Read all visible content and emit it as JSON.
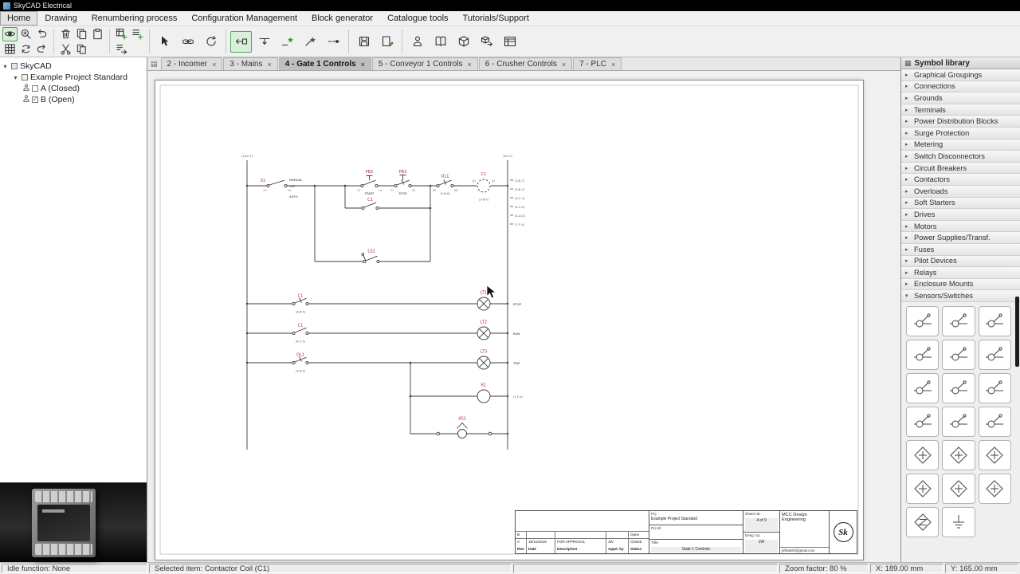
{
  "icons": {
    "close": "×",
    "chevron_right": "▸",
    "chevron_down": "▾",
    "tree_expanded": "▾",
    "header_symbol": "▦",
    "tab_strip": "▤",
    "check": "✓"
  },
  "titlebar": {
    "title": "SkyCAD Electrical"
  },
  "menubar": {
    "items": [
      {
        "label": "Home",
        "active": true
      },
      {
        "label": "Drawing"
      },
      {
        "label": "Renumbering process"
      },
      {
        "label": "Configuration Management"
      },
      {
        "label": "Block generator"
      },
      {
        "label": "Catalogue tools"
      },
      {
        "label": "Tutorials/Support"
      }
    ]
  },
  "tree": {
    "root": "SkyCAD",
    "project": "Example Project Standard",
    "sheets": [
      {
        "label": "A (Closed)"
      },
      {
        "label": "B (Open)",
        "checked": true
      }
    ]
  },
  "tabs": [
    {
      "label": "2 - Incomer"
    },
    {
      "label": "3 - Mains"
    },
    {
      "label": "4 - Gate 1 Controls",
      "active": true
    },
    {
      "label": "5 - Conveyor 1 Controls"
    },
    {
      "label": "6 - Crusher Controls"
    },
    {
      "label": "7 - PLC"
    }
  ],
  "symbol_library": {
    "header": "Symbol library",
    "categories": [
      {
        "label": "Graphical Groupings"
      },
      {
        "label": "Connections"
      },
      {
        "label": "Grounds"
      },
      {
        "label": "Terminals"
      },
      {
        "label": "Power Distribution Blocks"
      },
      {
        "label": "Surge Protection"
      },
      {
        "label": "Metering"
      },
      {
        "label": "Switch Disconnectors"
      },
      {
        "label": "Circuit Breakers"
      },
      {
        "label": "Contactors"
      },
      {
        "label": "Overloads"
      },
      {
        "label": "Soft Starters"
      },
      {
        "label": "Drives"
      },
      {
        "label": "Motors"
      },
      {
        "label": "Power Supplies/Transf."
      },
      {
        "label": "Fuses"
      },
      {
        "label": "Pilot Devices"
      },
      {
        "label": "Relays"
      },
      {
        "label": "Enclosure Mounts"
      },
      {
        "label": "Sensors/Switches",
        "expanded": true
      }
    ],
    "symbols": [
      {
        "kind": "circ"
      },
      {
        "kind": "circ"
      },
      {
        "kind": "circ"
      },
      {
        "kind": "circ"
      },
      {
        "kind": "circ"
      },
      {
        "kind": "circ"
      },
      {
        "kind": "circ"
      },
      {
        "kind": "circ"
      },
      {
        "kind": "circ"
      },
      {
        "kind": "circ"
      },
      {
        "kind": "circ"
      },
      {
        "kind": "circ"
      },
      {
        "kind": "diam"
      },
      {
        "kind": "diam"
      },
      {
        "kind": "diam"
      },
      {
        "kind": "diam"
      },
      {
        "kind": "diam"
      },
      {
        "kind": "diam"
      },
      {
        "kind": "diamz"
      },
      {
        "kind": "gnd"
      }
    ]
  },
  "schematic": {
    "rail_left_label": "(24V-1)",
    "rail_right_label": "(0V-1)",
    "s1": {
      "tag": "S1",
      "pos1": "MANUAL",
      "pos2": "OFF",
      "pos3": "AUTO",
      "t1": "13",
      "t2": "14"
    },
    "pb2": {
      "tag": "PB2",
      "func": "START",
      "t1": "13",
      "t2": "14"
    },
    "pb3": {
      "tag": "PB3",
      "func": "STOP",
      "t1": "21",
      "t2": "22"
    },
    "ol1": {
      "tag": "OL1",
      "ref": "(3-B-6)",
      "t1": "95",
      "t2": "96"
    },
    "coil": {
      "tag": "C1",
      "ref": "(3-B-7)",
      "t1": "A1",
      "t2": "A2"
    },
    "aux": {
      "tag": "C1"
    },
    "ls2": {
      "tag": "LS2"
    },
    "crossrefs": [
      "(3-B-7)",
      "(3-B-7)",
      "(4-C-4)",
      "(4-C-4)",
      "(4-D-4)",
      "(7-F-4)"
    ],
    "lamp1": {
      "contact_tag": "C1",
      "contact_ref": "(4-B-5)",
      "tag": "LT1",
      "func": "STOP"
    },
    "lamp2": {
      "contact_tag": "C1",
      "contact_ref": "(4-C-5)",
      "tag": "LT2",
      "func": "RUN"
    },
    "lamp3": {
      "contact_tag": "OL1",
      "contact_ref": "(3-B-5)",
      "tag": "LT3",
      "func": "TRIP"
    },
    "r1": {
      "tag": "R1",
      "ref": "(7-F-4)"
    },
    "as1": {
      "tag": "AS1"
    }
  },
  "titleblock": {
    "prj_label": "Prj:",
    "prj_value": "Example Project Standard",
    "prjnb_label": "Prj nb:",
    "sheet_label": "Sheet nb.",
    "sheet_value": "4 of 9",
    "desg_label": "Desg. by:",
    "desg_value": "JW",
    "company": "MCC Design Engineering",
    "email": "jeffwalsh@gmail.com",
    "title_label": "Title:",
    "title_value": "Gate 1 Controls",
    "logo": "Sk",
    "headers": [
      "Rev.",
      "Date",
      "Description",
      "Appd. by",
      "Status"
    ],
    "rows": [
      {
        "rev": "B",
        "date": "",
        "desc": "",
        "appd": "",
        "status": "Open"
      },
      {
        "rev": "A",
        "date": "15/11/2018",
        "desc": "FOR APPROVAL",
        "appd": "JW",
        "status": "Closed"
      }
    ]
  },
  "statusbar": {
    "idle": "Idle function: None",
    "selected": "Selected item: Contactor Coil (C1)",
    "zoom": "Zoom factor: 80 %",
    "x": "X: 189.00 mm",
    "y": "Y: 165.00 mm"
  }
}
